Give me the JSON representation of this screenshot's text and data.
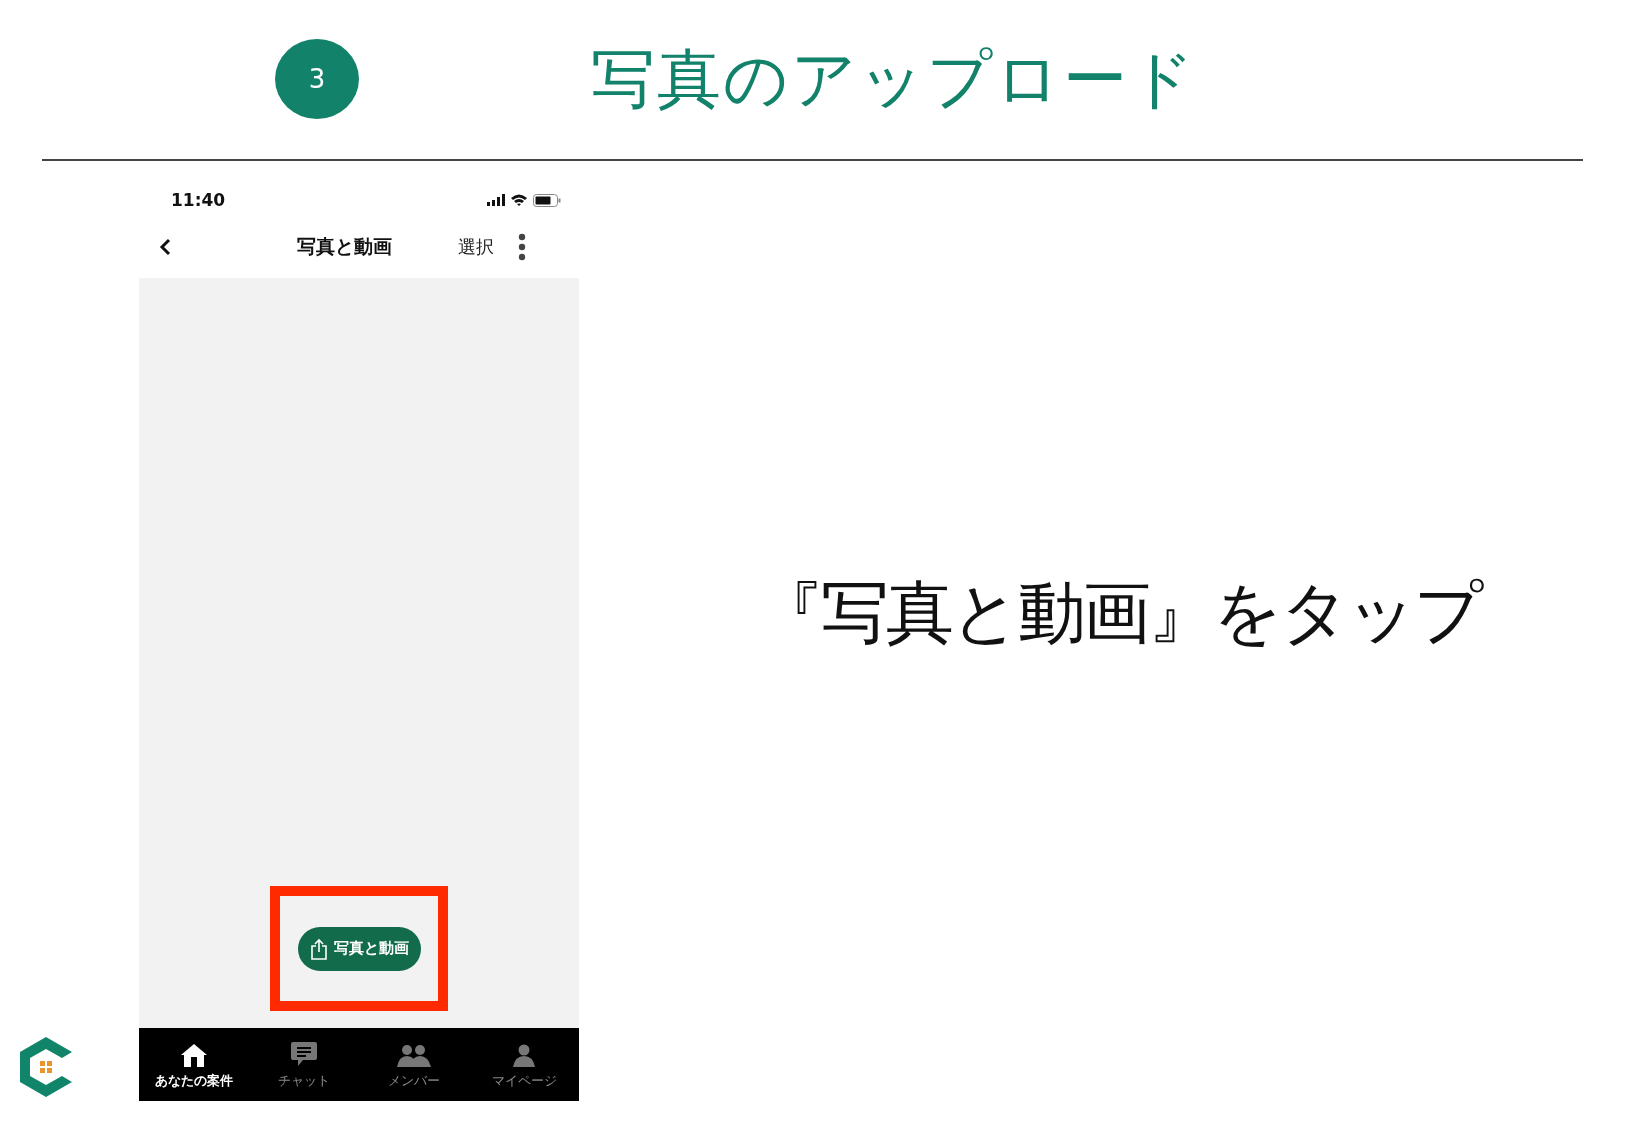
{
  "step": {
    "number": "3",
    "title": "写真のアップロード"
  },
  "phone": {
    "time": "11:40",
    "nav": {
      "title": "写真と動画",
      "action": "選択"
    },
    "upload_button": {
      "label": "写真と動画",
      "highlighted": true
    },
    "tabs": [
      {
        "kind": "home",
        "label": "あなたの案件",
        "selected": true
      },
      {
        "kind": "chat",
        "label": "チャット",
        "selected": false
      },
      {
        "kind": "members",
        "label": "メンバー",
        "selected": false
      },
      {
        "kind": "profile",
        "label": "マイページ",
        "selected": false
      }
    ]
  },
  "instruction": "『写真と動画』をタップ"
}
